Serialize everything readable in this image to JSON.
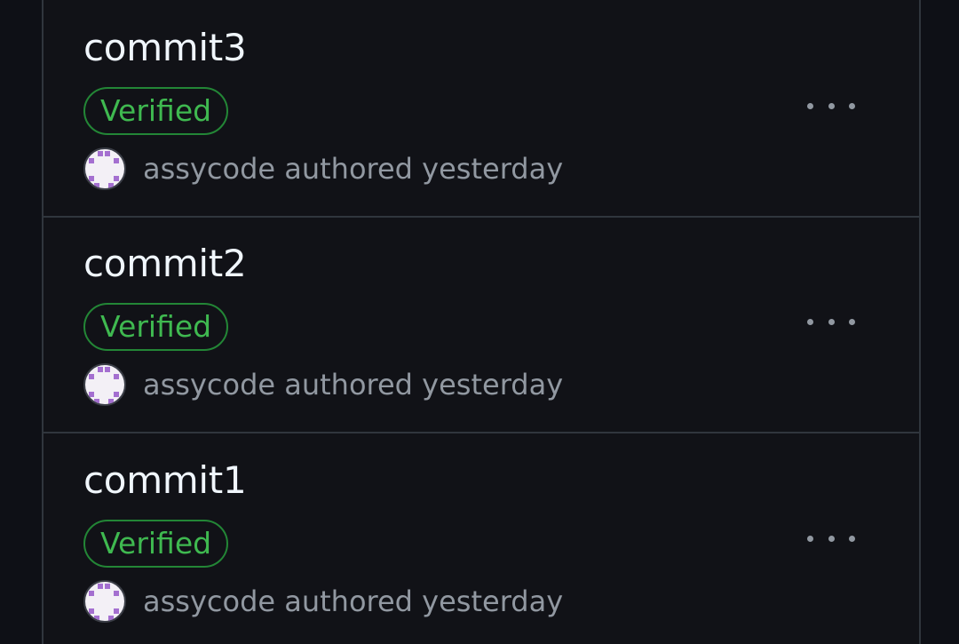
{
  "commits": [
    {
      "title": "commit3",
      "badge": "Verified",
      "author": "assycode",
      "verb": "authored",
      "time": "yesterday"
    },
    {
      "title": "commit2",
      "badge": "Verified",
      "author": "assycode",
      "verb": "authored",
      "time": "yesterday"
    },
    {
      "title": "commit1",
      "badge": "Verified",
      "author": "assycode",
      "verb": "authored",
      "time": "yesterday"
    }
  ],
  "icons": {
    "more": "kebab-horizontal-icon",
    "avatar": "identicon-avatar"
  },
  "colors": {
    "background": "#0e1016",
    "panel": "#111217",
    "border": "#30363d",
    "title": "#f0f6fc",
    "muted": "#9198a1",
    "verified_border": "#238636",
    "verified_text": "#3fb950",
    "avatar_accent": "#a46fd0"
  }
}
